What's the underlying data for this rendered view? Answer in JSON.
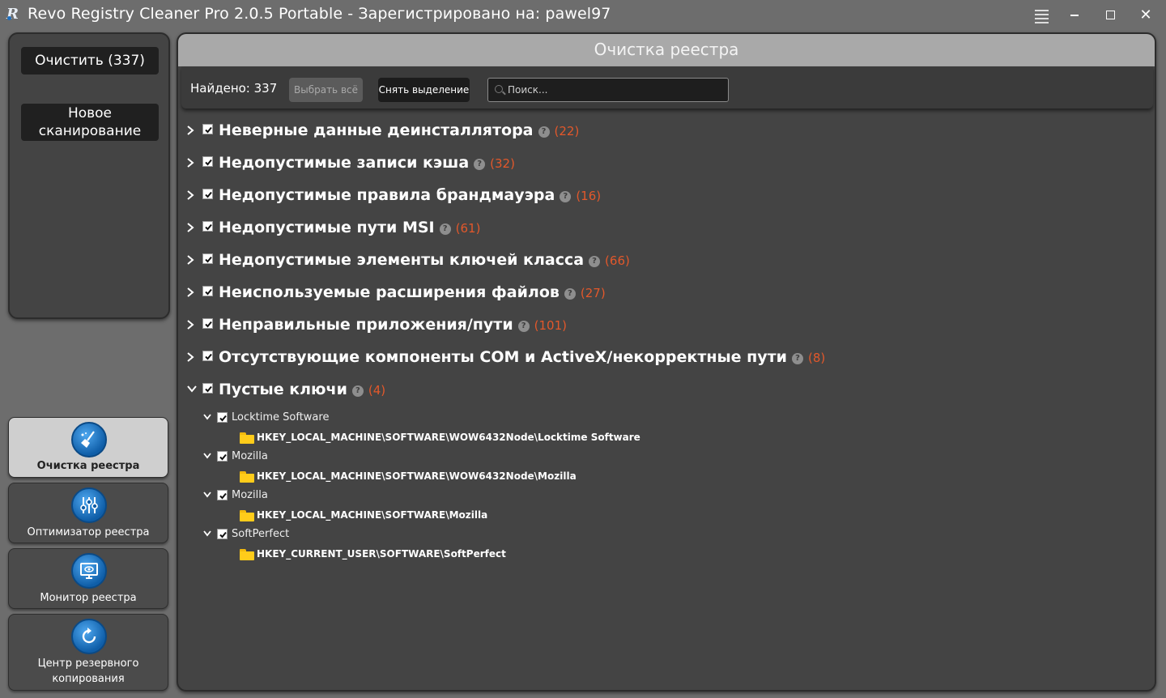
{
  "window": {
    "title": "Revo Registry Cleaner Pro 2.0.5 Portable - Зарегистрировано на: pawel97"
  },
  "sidebar": {
    "clean_button": "Очистить (337)",
    "new_scan_button_line1": "Новое",
    "new_scan_button_line2": "сканирование",
    "nav": [
      {
        "label": "Очистка реестра",
        "icon": "broom-icon",
        "active": true
      },
      {
        "label": "Оптимизатор реестра",
        "icon": "sliders-icon",
        "active": false
      },
      {
        "label": "Монитор реестра",
        "icon": "monitor-icon",
        "active": false
      },
      {
        "label_line1": "Центр резервного",
        "label_line2": "копирования",
        "icon": "backup-icon",
        "active": false
      }
    ]
  },
  "main": {
    "header": "Очистка реестра",
    "toolbar": {
      "found": "Найдено: 337",
      "select_all": "Выбрать всё",
      "deselect": "Снять выделение",
      "search_placeholder": "Поиск..."
    },
    "categories": [
      {
        "label": "Неверные данные деинсталлятора",
        "count": "(22)",
        "expanded": false,
        "checked": true
      },
      {
        "label": "Недопустимые записи кэша",
        "count": "(32)",
        "expanded": false,
        "checked": true
      },
      {
        "label": "Недопустимые правила брандмауэра",
        "count": "(16)",
        "expanded": false,
        "checked": true
      },
      {
        "label": "Недопустимые пути MSI",
        "count": "(61)",
        "expanded": false,
        "checked": true
      },
      {
        "label": "Недопустимые элементы ключей класса",
        "count": "(66)",
        "expanded": false,
        "checked": true
      },
      {
        "label": "Неиспользуемые расширения файлов",
        "count": "(27)",
        "expanded": false,
        "checked": true
      },
      {
        "label": "Неправильные приложения/пути",
        "count": "(101)",
        "expanded": false,
        "checked": true
      },
      {
        "label": "Отсутствующие компоненты COM и ActiveX/некорректные пути",
        "count": "(8)",
        "expanded": false,
        "checked": true
      },
      {
        "label": "Пустые ключи",
        "count": "(4)",
        "expanded": true,
        "checked": true
      }
    ],
    "empty_keys": [
      {
        "name": "Locktime Software",
        "path": "HKEY_LOCAL_MACHINE\\SOFTWARE\\WOW6432Node\\Locktime Software"
      },
      {
        "name": "Mozilla",
        "path": "HKEY_LOCAL_MACHINE\\SOFTWARE\\WOW6432Node\\Mozilla"
      },
      {
        "name": "Mozilla",
        "path": "HKEY_LOCAL_MACHINE\\SOFTWARE\\Mozilla"
      },
      {
        "name": "SoftPerfect",
        "path": "HKEY_CURRENT_USER\\SOFTWARE\\SoftPerfect"
      }
    ]
  },
  "colors": {
    "count": "#e2582b",
    "folder": "#ffcc1a",
    "nav_icon": "#1f7fd6"
  }
}
